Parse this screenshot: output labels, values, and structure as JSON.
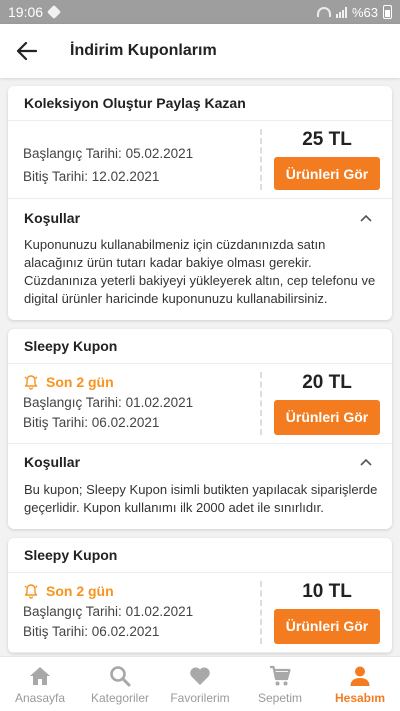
{
  "status_bar": {
    "time": "19:06",
    "battery": "%63"
  },
  "header": {
    "title": "İndirim Kuponlarım"
  },
  "coupons": [
    {
      "title": "Koleksiyon Oluştur Paylaş Kazan",
      "start_label": "Başlangıç Tarihi:",
      "start_date": "05.02.2021",
      "end_label": "Bitiş Tarihi:",
      "end_date": "12.02.2021",
      "amount": "25 TL",
      "button_label": "Ürünleri Gör",
      "conditions_title": "Koşullar",
      "conditions_text": "Kuponunuzu kullanabilmeniz için cüzdanınızda satın alacağınız ürün tutarı kadar bakiye olması gerekir. Cüzdanınıza yeterli bakiyeyi yükleyerek altın, cep telefonu ve digital ürünler haricinde kuponunuzu kullanabilirsiniz."
    },
    {
      "title": "Sleepy Kupon",
      "deadline": "Son 2 gün",
      "start_label": "Başlangıç Tarihi:",
      "start_date": "01.02.2021",
      "end_label": "Bitiş Tarihi:",
      "end_date": "06.02.2021",
      "amount": "20 TL",
      "button_label": "Ürünleri Gör",
      "conditions_title": "Koşullar",
      "conditions_text": "Bu kupon; Sleepy Kupon isimli butikten yapılacak siparişlerde geçerlidir. Kupon kullanımı ilk 2000 adet ile sınırlıdır."
    },
    {
      "title": "Sleepy Kupon",
      "deadline": "Son 2 gün",
      "start_label": "Başlangıç Tarihi:",
      "start_date": "01.02.2021",
      "end_label": "Bitiş Tarihi:",
      "end_date": "06.02.2021",
      "amount": "10 TL",
      "button_label": "Ürünleri Gör"
    }
  ],
  "bottom_nav": [
    {
      "label": "Anasayfa",
      "icon": "home-icon"
    },
    {
      "label": "Kategoriler",
      "icon": "search-icon"
    },
    {
      "label": "Favorilerim",
      "icon": "heart-icon"
    },
    {
      "label": "Sepetim",
      "icon": "cart-icon"
    },
    {
      "label": "Hesabım",
      "icon": "person-icon",
      "active": true
    }
  ],
  "colors": {
    "accent": "#f47c20",
    "deadline": "#f7941d",
    "status_bar": "#9e9e9e"
  }
}
